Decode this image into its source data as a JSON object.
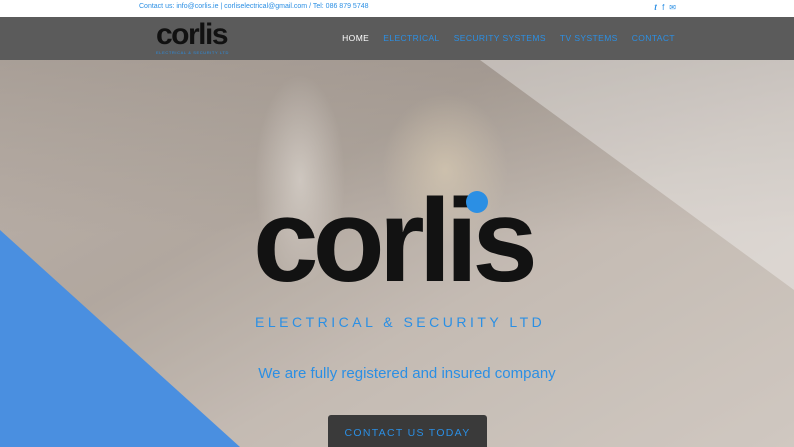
{
  "topbar": {
    "contact_text": "Contact us: info@corlis.ie | corliselectrical@gmail.com / Tel: 086 879 5748",
    "social": [
      {
        "icon": "twitter-icon",
        "glyph": "𝕥"
      },
      {
        "icon": "facebook-icon",
        "glyph": "f"
      },
      {
        "icon": "mail-icon",
        "glyph": "✉"
      }
    ]
  },
  "header": {
    "logo_word": "corlis",
    "logo_sub": "ELECTRICAL & SECURITY LTD",
    "nav": [
      {
        "label": "HOME",
        "active": true
      },
      {
        "label": "ELECTRICAL",
        "active": false
      },
      {
        "label": "SECURITY SYSTEMS",
        "active": false
      },
      {
        "label": "TV SYSTEMS",
        "active": false
      },
      {
        "label": "CONTACT",
        "active": false
      }
    ]
  },
  "hero": {
    "logo_word": "corlis",
    "logo_sub": "ELECTRICAL & SECURITY LTD",
    "tagline": "We are fully registered and insured company",
    "cta_label": "CONTACT US TODAY"
  },
  "colors": {
    "accent": "#2b8fe4",
    "header_bg": "#5b5b5b",
    "button_bg": "#3a3a3a"
  }
}
